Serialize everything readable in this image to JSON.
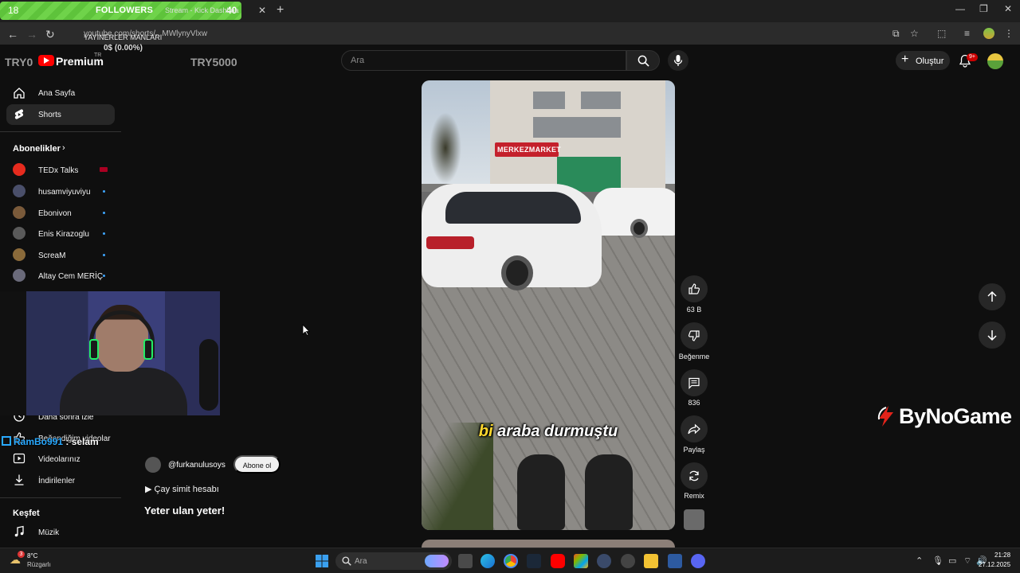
{
  "browser": {
    "followers_overlay": {
      "left_count": "18",
      "label": "FOLLOWERS",
      "right_count": "40"
    },
    "tab_title": "Stream - Kick Dashboa",
    "url": "youtube.com/shorts/...MWlynyVlxw",
    "overlay_title": "YAYINERLER MANLARI",
    "overlay_sub": "0$ (0.00%)"
  },
  "header": {
    "logo_text": "Premium",
    "logo_region": "TR",
    "donation_left": "TRY0",
    "donation_right": "TRY5000",
    "search_placeholder": "Ara",
    "create_label": "Oluştur",
    "notification_badge": "9+"
  },
  "sidebar": {
    "nav": [
      {
        "label": "Ana Sayfa",
        "icon": "home-icon"
      },
      {
        "label": "Shorts",
        "icon": "shorts-icon"
      }
    ],
    "subscriptions_heading": "Abonelikler",
    "subscriptions": [
      {
        "label": "TEDx Talks",
        "color": "#e62b1e"
      },
      {
        "label": "husamviyuviyu",
        "color": "#4a4f6a"
      },
      {
        "label": "Ebonivon",
        "color": "#7a5a3a"
      },
      {
        "label": "Enis Kirazoglu",
        "color": "#5a5a5a"
      },
      {
        "label": "ScreaM",
        "color": "#8a6a3a"
      },
      {
        "label": "Altay Cem MERİÇ",
        "color": "#6a6a7a"
      }
    ],
    "you_items": [
      {
        "label": "Daha sonra izle",
        "icon": "clock-icon"
      },
      {
        "label": "Beğendiğim videolar",
        "icon": "like-icon"
      },
      {
        "label": "Videolarınız",
        "icon": "video-icon"
      },
      {
        "label": "İndirilenler",
        "icon": "download-icon"
      }
    ],
    "explore_heading": "Keşfet",
    "explore_items": [
      {
        "label": "Müzik",
        "icon": "music-icon"
      }
    ]
  },
  "stream_chat": {
    "user": "RamBo991",
    "message": " : selam"
  },
  "short": {
    "channel": "@furkanulusoys",
    "subscribe_label": "Abone ol",
    "music": "Çay simit hesabı",
    "title": "Yeter ulan yeter!",
    "caption_highlight": "bi",
    "caption_rest": " araba durmuştu",
    "shop_sign": "MERKEZMARKET",
    "actions": [
      {
        "name": "like",
        "label": "63 B"
      },
      {
        "name": "dislike",
        "label": "Beğenme"
      },
      {
        "name": "comments",
        "label": "836"
      },
      {
        "name": "share",
        "label": "Paylaş"
      },
      {
        "name": "remix",
        "label": "Remix"
      }
    ]
  },
  "brand_watermark": "ByNoGame",
  "taskbar": {
    "weather_badge": "3",
    "weather_temp": "8°C",
    "weather_desc": "Rüzgarlı",
    "search_placeholder": "Ara",
    "time": "21:28",
    "date": "27.12.2025"
  }
}
